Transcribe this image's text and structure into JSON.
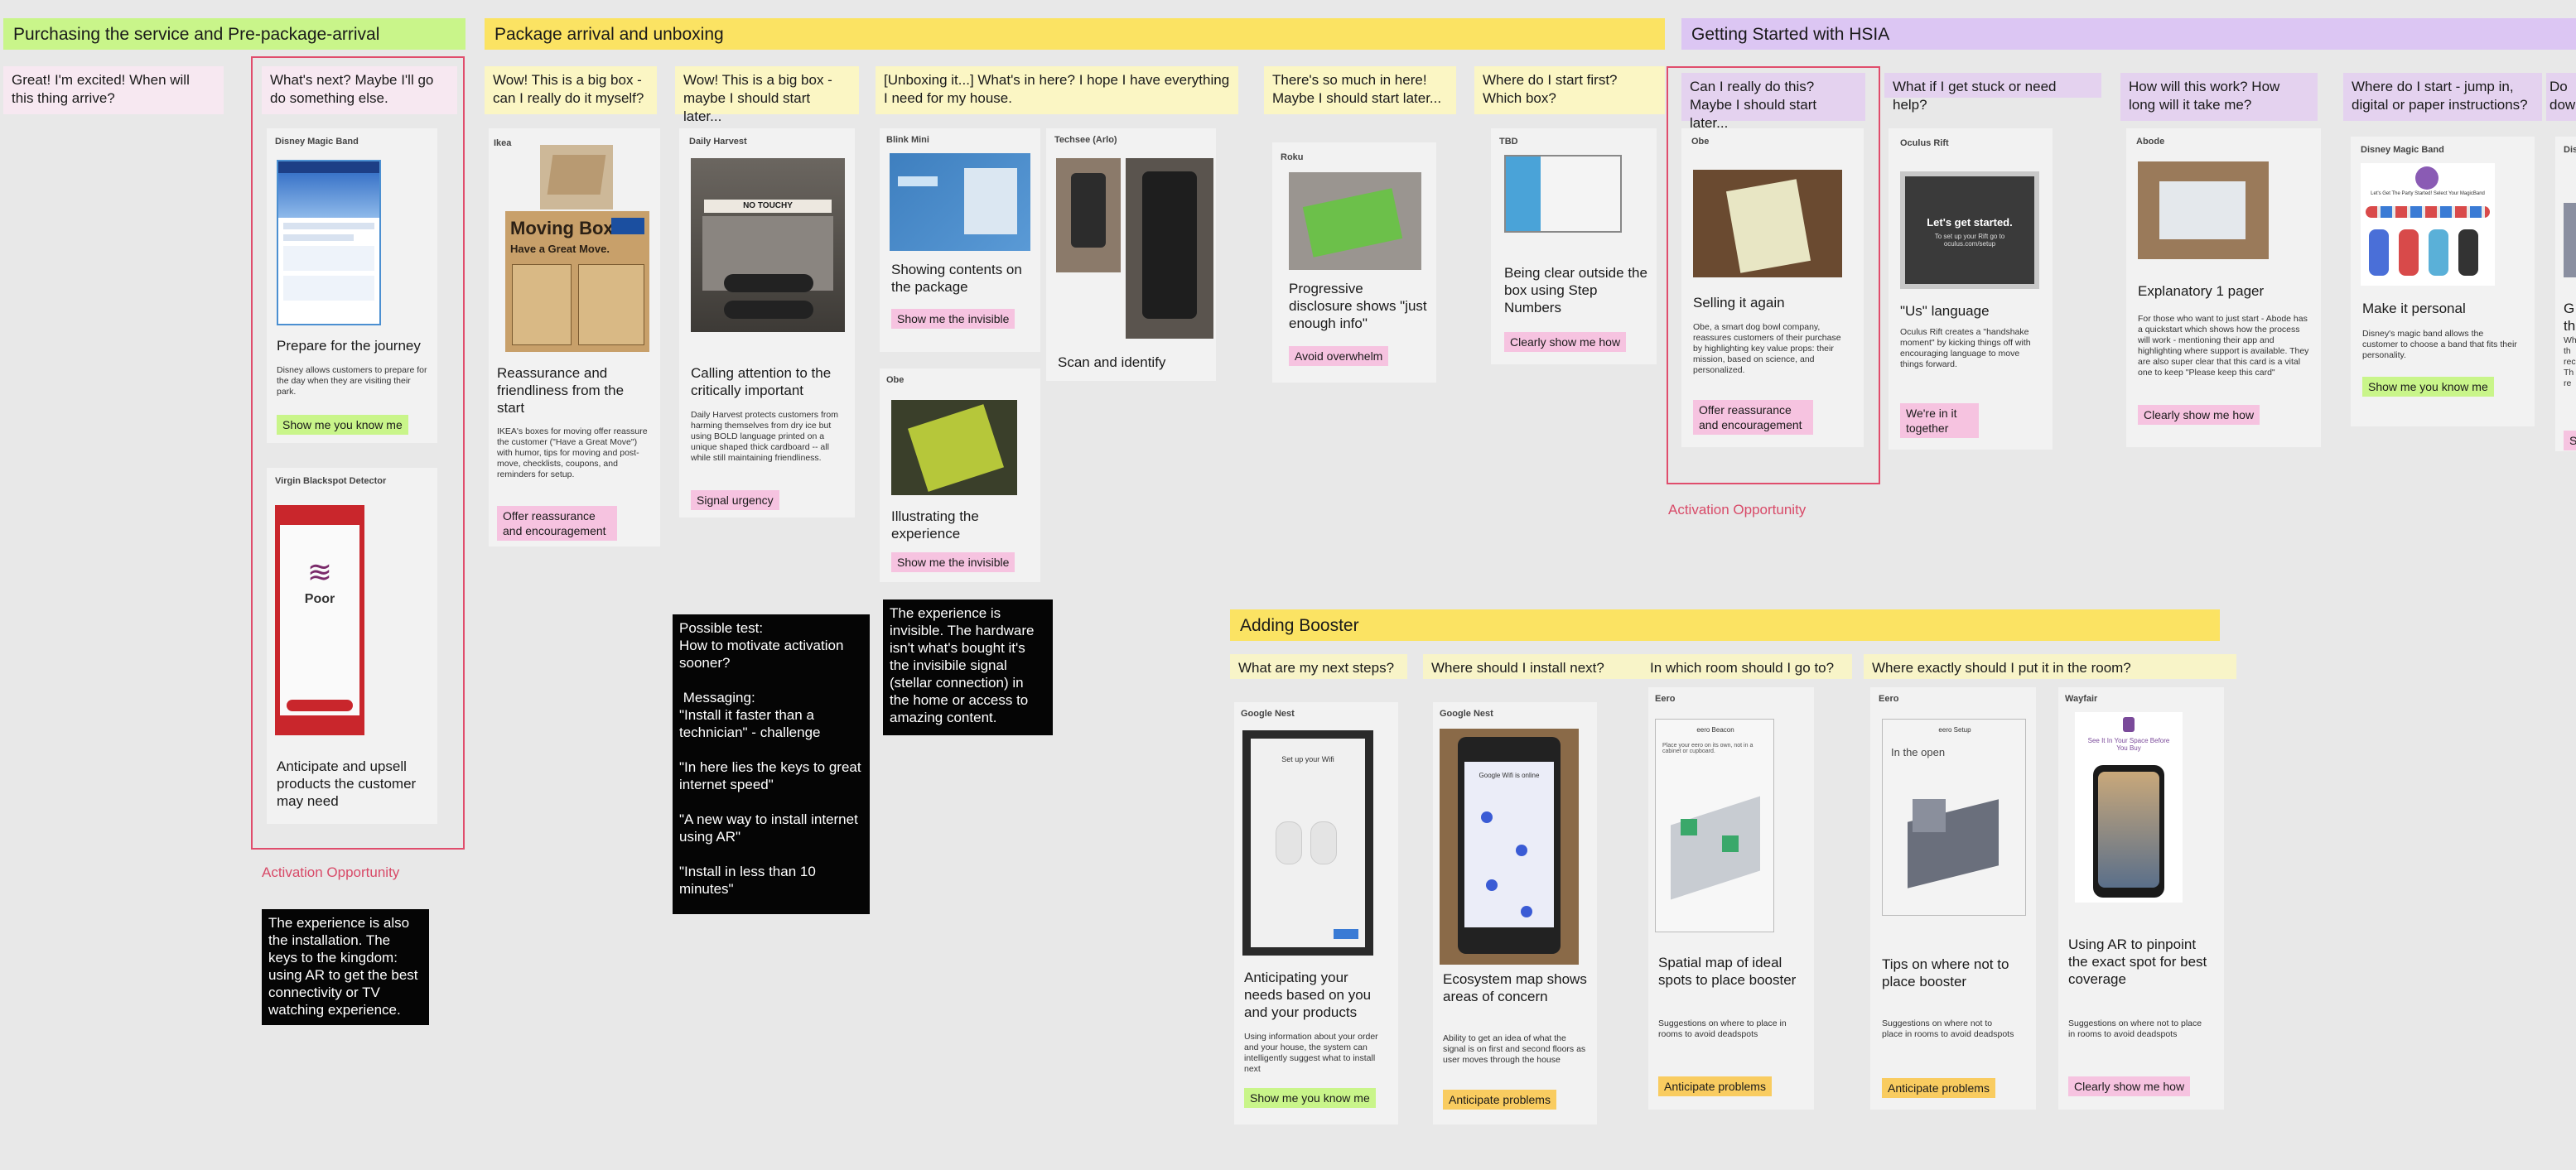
{
  "sections": {
    "purchasing": "Purchasing the service and Pre-package-arrival",
    "package": "Package arrival and unboxing",
    "getting_started": "Getting Started with HSIA",
    "booster": "Adding Booster"
  },
  "stickies": {
    "great": "Great!  I'm excited!  When will this thing arrive?",
    "whats_next": "What's next?  Maybe I'll go do something else.",
    "wow1": "Wow!  This is a big box - can I really do it myself?",
    "wow2": "Wow!  This is a big box - maybe I should start later...",
    "unboxing": "[Unboxing it...] What's in here?  I hope I have everything I need for my house.",
    "so_much": "There's so much in here! Maybe I should start later...",
    "where_start": "Where do I start first? Which box?",
    "can_really": "Can I really do this? Maybe I should start later...",
    "stuck": "What if I get stuck or need help?",
    "how_work": "How will this work?  How long will it take me?",
    "jump_in": "Where do I start - jump in, digital or paper instructions?",
    "do_dow": "Do dow",
    "next_steps": "What are my next steps?",
    "install_next": "Where should I install next?",
    "which_room": "In which room should I go to?",
    "where_exactly": "Where exactly should I put it in the room?"
  },
  "cards": {
    "disney1": {
      "brand": "Disney Magic Band",
      "title": "Prepare for the journey",
      "desc": "Disney allows customers to prepare for the day when they are visiting their park.",
      "tag": "Show me you know me"
    },
    "virgin": {
      "brand": "Virgin Blackspot Detector",
      "title": "Anticipate and upsell products the customer may need",
      "screen_title": "Poor"
    },
    "ikea": {
      "brand": "Ikea",
      "title": "Reassurance and friendliness from the start",
      "desc": "IKEA's boxes for moving offer reassure the customer (\"Have a Great Move\") with humor, tips for moving and post-move, checklists, coupons, and reminders for setup.",
      "tag": "Offer reassurance and encouragement",
      "box_title": "Moving Box",
      "box_sub": "Have a Great Move."
    },
    "daily_harvest": {
      "brand": "Daily Harvest",
      "title": "Calling attention to the critically important",
      "desc": "Daily Harvest protects customers from harming themselves from dry ice but using BOLD language printed on a unique shaped thick cardboard -- all while still maintaining friendliness.",
      "tag": "Signal urgency",
      "box_text": "NO TOUCHY"
    },
    "blink": {
      "brand": "Blink Mini",
      "title": "Showing contents on the package",
      "tag": "Show me the invisible"
    },
    "techsee": {
      "brand": "Techsee (Arlo)",
      "title": "Scan and identify"
    },
    "obe1": {
      "brand": "Obe",
      "title": "Illustrating the experience",
      "tag": "Show me the invisible"
    },
    "roku": {
      "brand": "Roku",
      "title": "Progressive disclosure shows \"just enough info\"",
      "tag": "Avoid overwhelm"
    },
    "tbd": {
      "brand": "TBD",
      "title": "Being clear outside the box using Step Numbers",
      "tag": "Clearly show me how"
    },
    "obe2": {
      "brand": "Obe",
      "title": "Selling it again",
      "desc": "Obe, a smart dog bowl company, reassures customers of their purchase by highlighting key value props:  their mission, based on science, and personalized.",
      "tag": "Offer reassurance and encouragement"
    },
    "oculus": {
      "brand": "Oculus Rift",
      "title": "\"Us\" language",
      "desc": "Oculus Rift creates a \"handshake moment\" by kicking things off with encouraging language to move things forward.",
      "tag": "We're in it together",
      "screen_title": "Let's get started.",
      "screen_sub": "To set up your Rift go to oculus.com/setup"
    },
    "abode": {
      "brand": "Abode",
      "title": "Explanatory 1 pager",
      "desc": "For those who want to just start - Abode has a quickstart which shows how the process will work - mentioning their app and highlighting where support is available.  They are also super clear that this card is a vital one to keep \"Please keep this card\"",
      "tag": "Clearly show me how"
    },
    "disney2": {
      "brand": "Disney Magic Band",
      "title": "Make it personal",
      "desc": "Disney's magic band allows the customer to choose a band that fits their personality.",
      "tag": "Show me you know me",
      "screen_title": "Let's Get The Party Started! Select Your MagicBand"
    },
    "disney3": {
      "brand": "Disn",
      "title": "G th",
      "desc": "Wh th rec Th re",
      "tag": "S"
    },
    "nest1": {
      "brand": "Google Nest",
      "title": "Anticipating your needs based on you and your products",
      "desc": "Using information about your order and your house, the system can intelligently suggest what to install next",
      "tag": "Show me you know me",
      "screen_title": "Set up your Wifi"
    },
    "nest2": {
      "brand": "Google Nest",
      "title": "Ecosystem map shows areas of concern",
      "desc": "Ability to get an idea of what the signal is on first and second floors as user moves through the house",
      "tag": "Anticipate problems",
      "screen_title": "Google Wifi is online"
    },
    "eero1": {
      "brand": "Eero",
      "title": "Spatial map of ideal spots to place booster",
      "desc": "Suggestions on where to place in rooms to avoid deadspots",
      "tag": "Anticipate problems",
      "screen_title": "eero Beacon",
      "screen_sub": "Place your eero on its own, not in a cabinet or cupboard."
    },
    "eero2": {
      "brand": "Eero",
      "title": "Tips on where not to place booster",
      "desc": "Suggestions on where not to place in rooms to avoid deadspots",
      "tag": "Anticipate problems",
      "screen_title": "eero Setup",
      "screen_sub": "In the open"
    },
    "wayfair": {
      "brand": "Wayfair",
      "title": "Using AR to pinpoint the exact spot for best coverage",
      "desc": "Suggestions on where not to place in rooms to avoid deadspots",
      "tag": "Clearly show me how",
      "screen_title": "See It In Your Space Before You Buy"
    }
  },
  "notes": {
    "experience_install": "The experience is also the installation.  The keys to the kingdom: using AR to get the best connectivity or TV watching experience.",
    "possible_test": "Possible test:\nHow to motivate activation sooner?\n\n Messaging:\n\"Install it faster than a technician\" - challenge\n\n\"In here lies the keys to great internet speed\"\n\n\"A new way to install internet using AR\"\n\n\"Install in less than 10 minutes\"",
    "invisible": "The experience is invisible. The hardware isn't what's bought it's the invisibile signal (stellar connection) in the home or access to amazing content."
  },
  "labels": {
    "activation1": "Activation Opportunity",
    "activation2": "Activation Opportunity"
  },
  "colors": {
    "canvas": "#e8e8e8",
    "green_header": "#c9f58a",
    "yellow_header": "#fbe363",
    "purple_header": "#dcc6f3",
    "highlight_border": "#e04d6c",
    "tag_pink": "#f6c3e0",
    "tag_green": "#c9f58a",
    "tag_orange": "#f9cc60"
  },
  "icons": [
    "wifi-icon"
  ]
}
